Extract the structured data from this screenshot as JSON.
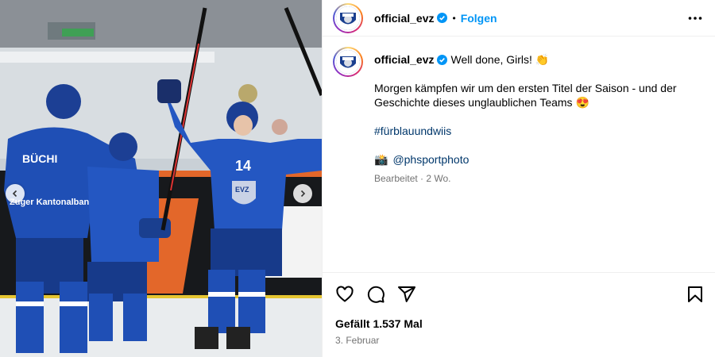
{
  "post": {
    "username": "official_evz",
    "follow_label": "Folgen",
    "separator": "•",
    "caption_title": "Well done, Girls! 👏",
    "caption_text": "Morgen kämpfen wir um den ersten Titel der Saison - und der Geschichte dieses unglaublichen Teams 😍",
    "hashtag": "#fürblauundwiis",
    "credit_icon": "📸",
    "credit_handle": "@phsportphoto",
    "edited_label": "Bearbeitet · 2 Wo.",
    "likes": "Gefällt 1.537 Mal",
    "date": "3. Februar"
  },
  "photo": {
    "jersey_number": "14",
    "jersey_name": "BÜCHI",
    "sponsor": "Zuger Kantonalbank",
    "crest": "EVZ"
  },
  "icons": {
    "verified": "verified-badge-icon",
    "more": "more-options-icon",
    "like": "heart-icon",
    "comment": "comment-icon",
    "share": "share-icon",
    "save": "bookmark-icon",
    "prev": "chevron-left-icon",
    "next": "chevron-right-icon"
  },
  "colors": {
    "accent": "#0095f6",
    "link": "#00376b",
    "muted": "#737373",
    "jersey": "#1f4fb5"
  }
}
